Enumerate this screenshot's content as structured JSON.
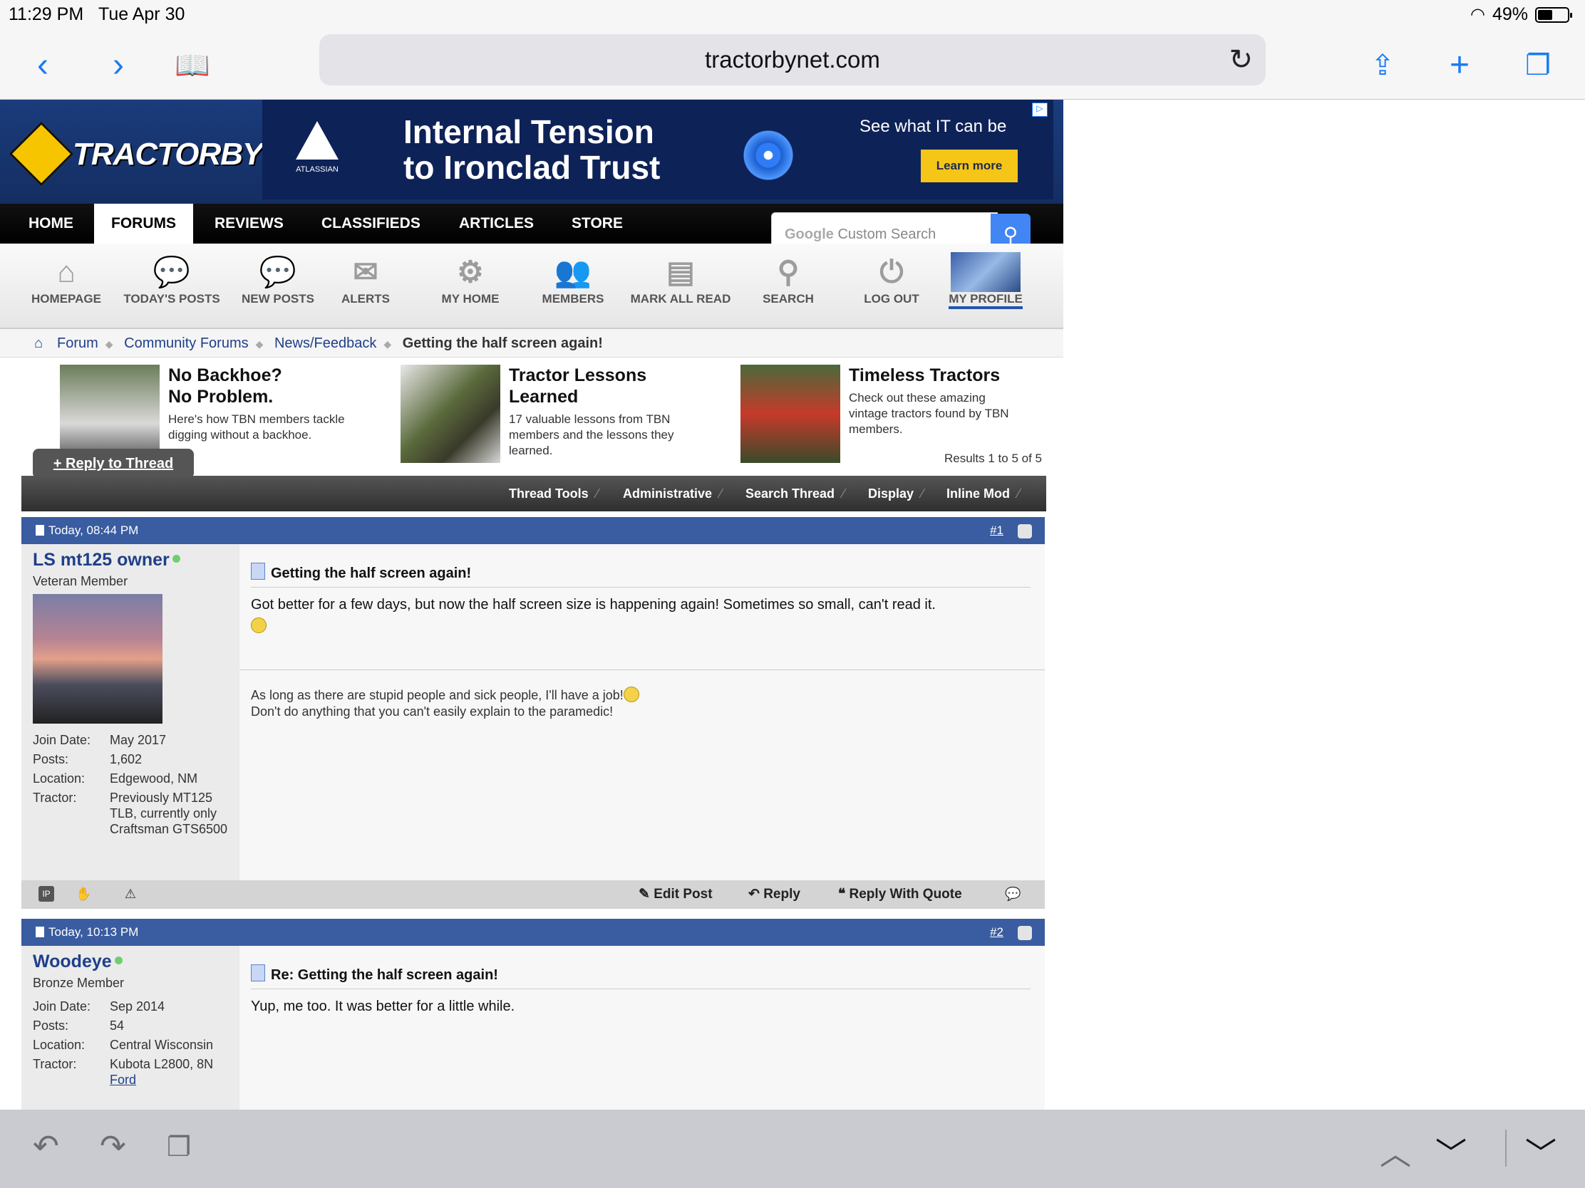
{
  "status": {
    "time": "11:29 PM",
    "date": "Tue Apr 30",
    "battery": "49%",
    "battery_level": 0.49
  },
  "browser": {
    "url": "tractorbynet.com"
  },
  "site": {
    "logo": "TRACTORBYNET",
    "ad": {
      "brand": "ATLASSIAN",
      "headline_1": "Internal Tension",
      "headline_2": "to Ironclad Trust",
      "tagline": "See what IT can be",
      "cta": "Learn more"
    },
    "nav": [
      "HOME",
      "FORUMS",
      "REVIEWS",
      "CLASSIFIEDS",
      "ARTICLES",
      "STORE"
    ],
    "search": {
      "brand": "Google",
      "placeholder": "Custom Search"
    },
    "subnav": [
      "HOMEPAGE",
      "TODAY'S POSTS",
      "NEW POSTS",
      "ALERTS",
      "MY HOME",
      "MEMBERS",
      "MARK ALL READ",
      "SEARCH",
      "LOG OUT",
      "MY PROFILE"
    ]
  },
  "breadcrumb": {
    "items": [
      "Forum",
      "Community Forums",
      "News/Feedback"
    ],
    "current": "Getting the half screen again!"
  },
  "promos": [
    {
      "title_1": "No Backhoe?",
      "title_2": "No Problem.",
      "desc": "Here's how TBN members tackle digging without a backhoe."
    },
    {
      "title_1": "Tractor Lessons",
      "title_2": "Learned",
      "desc": "17 valuable lessons from TBN members and the lessons they learned."
    },
    {
      "title_1": "Timeless Tractors",
      "title_2": "",
      "desc": "Check out these amazing vintage tractors found by TBN members."
    }
  ],
  "thread": {
    "reply_button": "+ Reply to Thread",
    "results": "Results 1 to 5 of 5",
    "tools": [
      "Thread Tools",
      "Administrative",
      "Search Thread",
      "Display",
      "Inline Mod"
    ]
  },
  "labels": {
    "join": "Join Date:",
    "posts": "Posts:",
    "location": "Location:",
    "tractor": "Tractor:"
  },
  "posts": [
    {
      "time": "Today, 08:44 PM",
      "number": "#1",
      "user": "LS mt125 owner",
      "rank": "Veteran Member",
      "join": "May 2017",
      "posts": "1,602",
      "location": "Edgewood, NM",
      "tractor": "Previously MT125 TLB, currently only Craftsman GTS6500",
      "title": "Getting the half screen again!",
      "text": "Got better for a few days, but now the half screen size is happening again! Sometimes so small, can't read it.",
      "sig_1": "As long as there are stupid people and sick people, I'll have a job!",
      "sig_2": "Don't do anything that you can't easily explain to the paramedic!",
      "actions": [
        "Edit Post",
        "Reply",
        "Reply With Quote"
      ]
    },
    {
      "time": "Today, 10:13 PM",
      "number": "#2",
      "user": "Woodeye",
      "rank": "Bronze Member",
      "join": "Sep 2014",
      "posts": "54",
      "location": "Central Wisconsin",
      "tractor": "Kubota L2800, 8N",
      "tractor_link": "Ford",
      "title": "Re: Getting the half screen again!",
      "text": "Yup, me too. It was better for a little while."
    }
  ]
}
